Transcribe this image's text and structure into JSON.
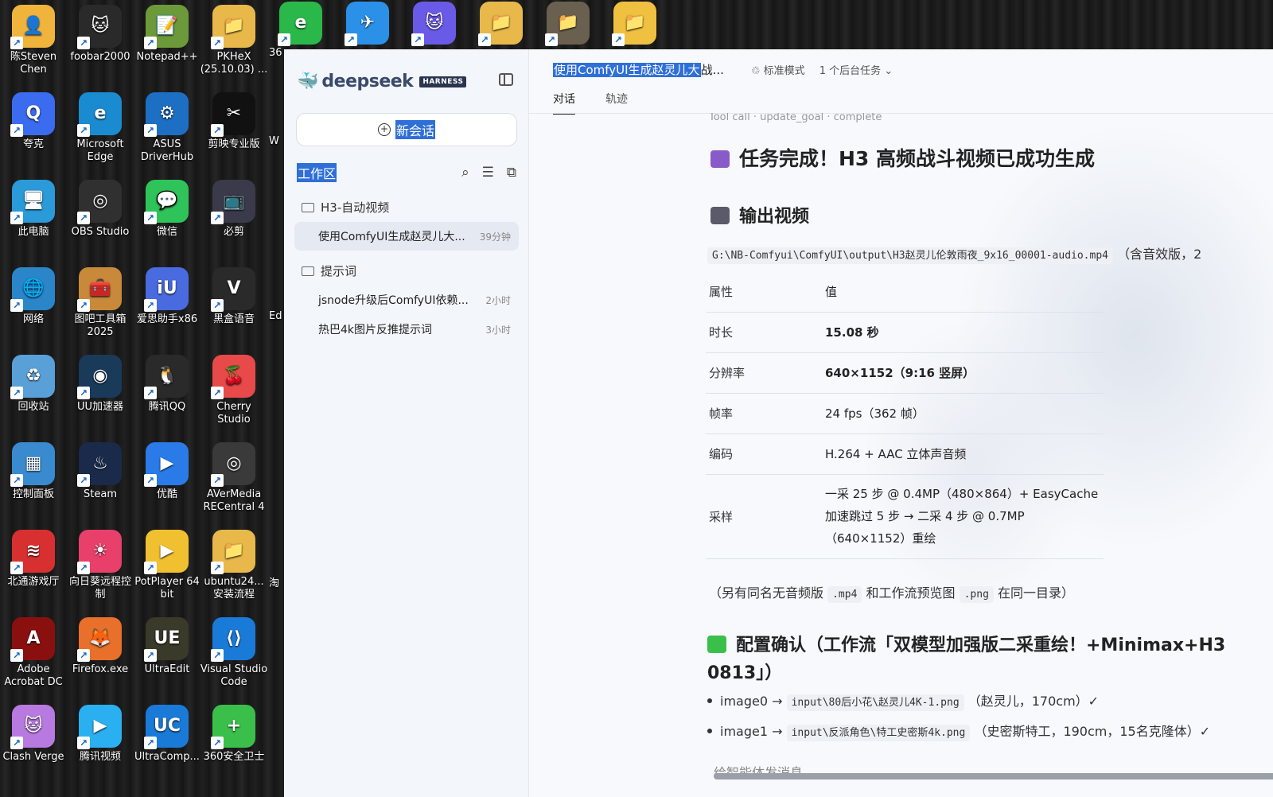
{
  "desktop": {
    "icons": [
      {
        "label": "陈Steven Chen",
        "glyph": "👤",
        "color": "#f0b43c"
      },
      {
        "label": "foobar2000",
        "glyph": "🐱",
        "color": "#2a2a2a"
      },
      {
        "label": "Notepad++",
        "glyph": "📝",
        "color": "#6c9a3a"
      },
      {
        "label": "PKHeX (25.10.03) ...",
        "glyph": "📁",
        "color": "#e8b84a"
      },
      {
        "label": "夸克",
        "glyph": "Q",
        "color": "#3b6cf0"
      },
      {
        "label": "Microsoft Edge",
        "glyph": "e",
        "color": "#1a8bd0"
      },
      {
        "label": "ASUS DriverHub",
        "glyph": "⚙",
        "color": "#1d6fc4"
      },
      {
        "label": "剪映专业版",
        "glyph": "✂",
        "color": "#111111"
      },
      {
        "label": "此电脑",
        "glyph": "🖥",
        "color": "#2a9ad8"
      },
      {
        "label": "OBS Studio",
        "glyph": "◎",
        "color": "#303030"
      },
      {
        "label": "微信",
        "glyph": "💬",
        "color": "#2ec45a"
      },
      {
        "label": "必剪",
        "glyph": "📺",
        "color": "#3a3a4a"
      },
      {
        "label": "网络",
        "glyph": "🌐",
        "color": "#2a86c8"
      },
      {
        "label": "图吧工具箱2025",
        "glyph": "🧰",
        "color": "#c88a3a"
      },
      {
        "label": "爱思助手x86",
        "glyph": "iU",
        "color": "#4a6ae0"
      },
      {
        "label": "黑盒语音",
        "glyph": "V",
        "color": "#2a2a2a"
      },
      {
        "label": "回收站",
        "glyph": "♻",
        "color": "#5aa0d8"
      },
      {
        "label": "UU加速器",
        "glyph": "◉",
        "color": "#1a3a5a"
      },
      {
        "label": "腾讯QQ",
        "glyph": "🐧",
        "color": "#2a2a2a"
      },
      {
        "label": "Cherry Studio",
        "glyph": "🍒",
        "color": "#e84a4a"
      },
      {
        "label": "控制面板",
        "glyph": "▦",
        "color": "#3a8ad0"
      },
      {
        "label": "Steam",
        "glyph": "♨",
        "color": "#1a2a4a"
      },
      {
        "label": "优酷",
        "glyph": "▶",
        "color": "#2a7ae8"
      },
      {
        "label": "AVerMedia RECentral 4",
        "glyph": "◎",
        "color": "#3a3a3a"
      },
      {
        "label": "北通游戏厅",
        "glyph": "≋",
        "color": "#d83030"
      },
      {
        "label": "向日葵远程控制",
        "glyph": "☀",
        "color": "#e8406a"
      },
      {
        "label": "PotPlayer 64 bit",
        "glyph": "▶",
        "color": "#f0c030"
      },
      {
        "label": "ubuntu24... 安装流程",
        "glyph": "📁",
        "color": "#e8b84a"
      },
      {
        "label": "Adobe Acrobat DC",
        "glyph": "A",
        "color": "#8a1010"
      },
      {
        "label": "Firefox.exe",
        "glyph": "🦊",
        "color": "#e8702a"
      },
      {
        "label": "UltraEdit",
        "glyph": "UE",
        "color": "#3a3a2a"
      },
      {
        "label": "Visual Studio Code",
        "glyph": "⟨⟩",
        "color": "#1a7ad8"
      },
      {
        "label": "Clash Verge",
        "glyph": "🐱",
        "color": "#b87ae0"
      },
      {
        "label": "腾讯视频",
        "glyph": "▶",
        "color": "#2ab0f0"
      },
      {
        "label": "UltraComp...",
        "glyph": "UC",
        "color": "#1a7ad8"
      },
      {
        "label": "360安全卫士",
        "glyph": "+",
        "color": "#3ac04a"
      }
    ],
    "top_row": [
      {
        "label": "",
        "glyph": "e",
        "color": "#2ab84a"
      },
      {
        "label": "",
        "glyph": "✈",
        "color": "#2a90e8"
      },
      {
        "label": "",
        "glyph": "🐱",
        "color": "#6a5ae8"
      },
      {
        "label": "",
        "glyph": "📁",
        "color": "#e8b84a"
      },
      {
        "label": "",
        "glyph": "📁",
        "color": "#6a6050"
      },
      {
        "label": "",
        "glyph": "📁",
        "color": "#f0c040"
      }
    ],
    "partial_labels": [
      "36",
      "W",
      "Ed",
      "淘"
    ]
  },
  "sidebar": {
    "brand": "deepseek",
    "badge": "HARNESS",
    "new_chat": "新会话",
    "workspace_title": "工作区",
    "folders": [
      {
        "name": "H3-自动视频",
        "items": [
          {
            "title": "使用ComfyUI生成赵灵儿大...",
            "time": "39分钟",
            "active": true
          }
        ]
      },
      {
        "name": "提示词",
        "items": [
          {
            "title": "jsnode升级后ComfyUI依赖...",
            "time": "2小时"
          },
          {
            "title": "热巴4k图片反推提示词",
            "time": "3小时"
          }
        ]
      }
    ]
  },
  "header": {
    "title_sel": "使用ComfyUI生成赵灵儿大",
    "title_rest": "战...",
    "mode": "标准模式",
    "bg_tasks": "1 个后台任务",
    "tabs": [
      "对话",
      "轨迹"
    ]
  },
  "content": {
    "cut_line": "Tool call · update_goal · complete",
    "heading": "任务完成！H3 高频战斗视频已成功生成",
    "output_heading": "输出视频",
    "path": "G:\\NB-Comfyui\\ComfyUI\\output\\H3赵灵儿伦敦雨夜_9x16_00001-audio.mp4",
    "path_suffix": "（含音效版，2",
    "table": {
      "header": [
        "属性",
        "值"
      ],
      "rows": [
        {
          "k": "时长",
          "v": "15.08 秒",
          "bold": true
        },
        {
          "k": "分辨率",
          "v": "640×1152（9:16 竖屏）",
          "bold": true
        },
        {
          "k": "帧率",
          "v": "24 fps（362 帧）"
        },
        {
          "k": "编码",
          "v": "H.264 + AAC 立体声音频"
        },
        {
          "k": "采样",
          "v1": "一采 25 步 @ 0.4MP（480×864）+ EasyCache",
          "v2": "加速跳过 5 步 → 二采 4 步 @ 0.7MP",
          "v3": "（640×1152）重绘"
        }
      ]
    },
    "note_a": "（另有同名无音频版 ",
    "note_code1": ".mp4",
    "note_b": " 和工作流预览图 ",
    "note_code2": ".png",
    "note_c": " 在同一目录）",
    "config_heading": "配置确认（工作流「双模型加强版二采重绘！+Minimax+H3 0813」）",
    "bullets": [
      {
        "name": "image0",
        "code": "input\\80后小花\\赵灵儿4K-1.png",
        "rest": "（赵灵儿，170cm）✓"
      },
      {
        "name": "image1",
        "code": "input\\反派角色\\特工史密斯4k.png",
        "rest": "（史密斯特工，190cm，15名克隆体）✓"
      }
    ]
  },
  "composer": {
    "placeholder": "给智能体发消息"
  }
}
